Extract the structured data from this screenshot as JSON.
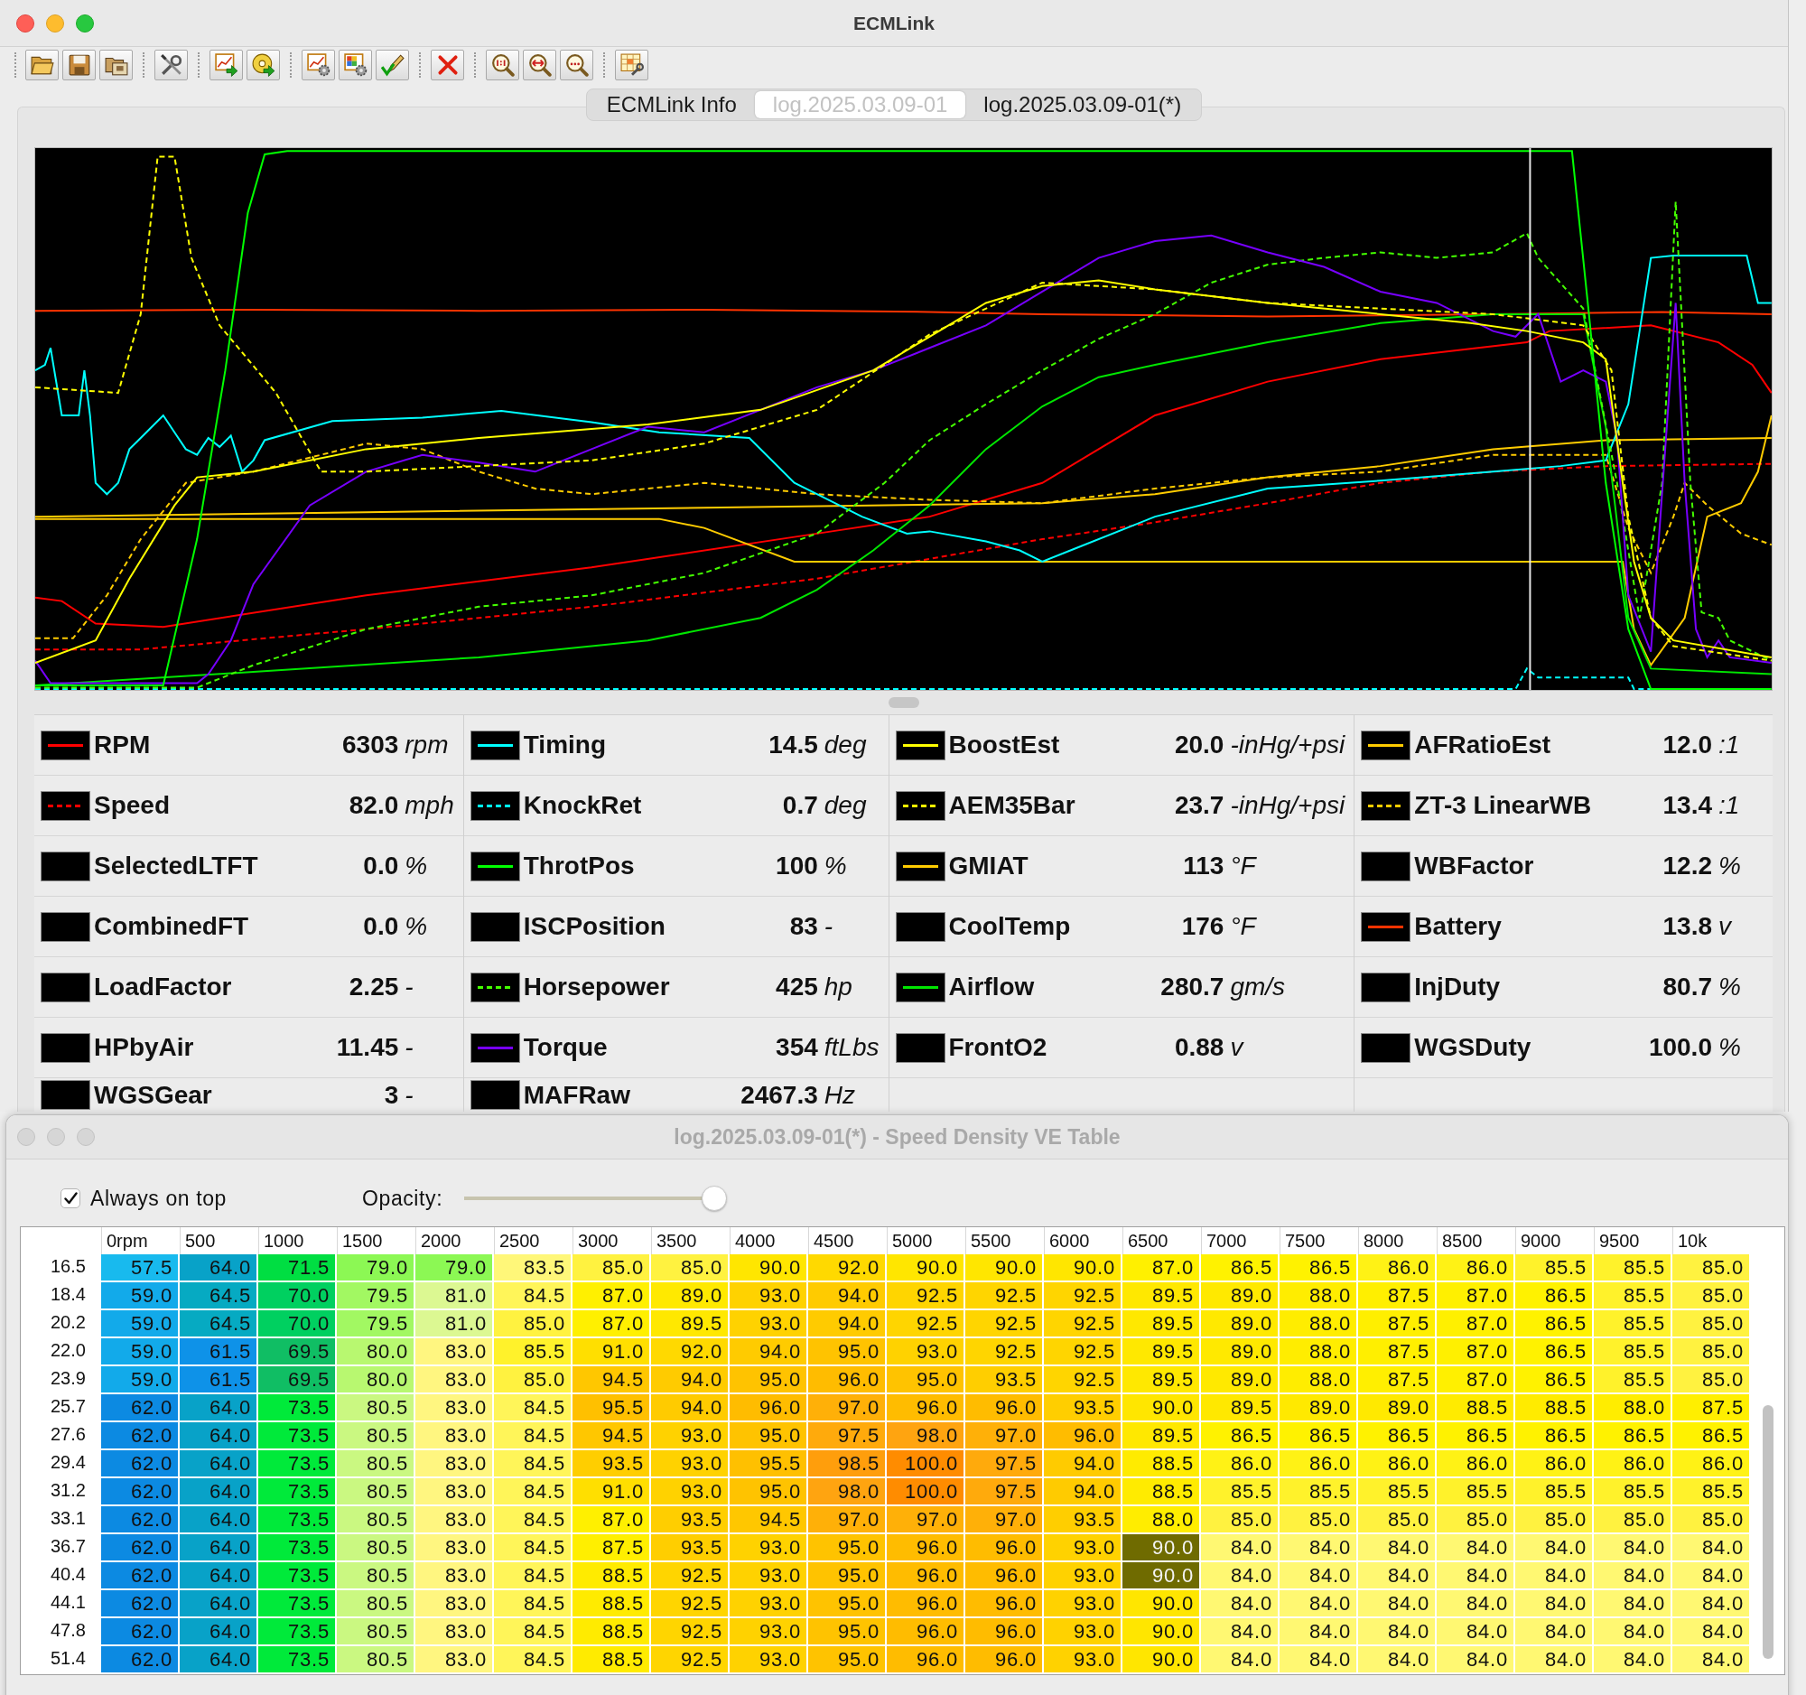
{
  "window": {
    "title": "ECMLink",
    "active": true
  },
  "tabs": [
    {
      "label": "ECMLink Info",
      "selected": false
    },
    {
      "label": "log.2025.03.09-01",
      "selected": true
    },
    {
      "label": "log.2025.03.09-01(*)",
      "selected": false
    }
  ],
  "gauge_columns": [
    {
      "gauges": [
        {
          "name": "RPM",
          "value": "6303",
          "unit": "rpm",
          "kind": "solid",
          "color": "#ff0000"
        },
        {
          "name": "Speed",
          "value": "82.0",
          "unit": "mph",
          "kind": "dashed",
          "color": "#ff0000"
        },
        {
          "name": "SelectedLTFT",
          "value": "0.0",
          "unit": "%",
          "kind": "none"
        },
        {
          "name": "CombinedFT",
          "value": "0.0",
          "unit": "%",
          "kind": "none"
        },
        {
          "name": "LoadFactor",
          "value": "2.25",
          "unit": "-",
          "kind": "none"
        },
        {
          "name": "HPbyAir",
          "value": "11.45",
          "unit": "-",
          "kind": "none"
        },
        {
          "name": "WGSGear",
          "value": "3",
          "unit": "-",
          "kind": "none"
        }
      ]
    },
    {
      "gauges": [
        {
          "name": "Timing",
          "value": "14.5",
          "unit": "deg",
          "kind": "solid",
          "color": "#00ffff"
        },
        {
          "name": "KnockRet",
          "value": "0.7",
          "unit": "deg",
          "kind": "dashed",
          "color": "#00ffff"
        },
        {
          "name": "ThrotPos",
          "value": "100",
          "unit": "%",
          "kind": "solid",
          "color": "#00ff00"
        },
        {
          "name": "ISCPosition",
          "value": "83",
          "unit": "-",
          "kind": "none"
        },
        {
          "name": "Horsepower",
          "value": "425",
          "unit": "hp",
          "kind": "dashed",
          "color": "#44ff00"
        },
        {
          "name": "Torque",
          "value": "354",
          "unit": "ftLbs",
          "kind": "solid",
          "color": "#7700ff"
        },
        {
          "name": "MAFRaw",
          "value": "2467.3",
          "unit": "Hz",
          "kind": "none"
        }
      ]
    },
    {
      "gauges": [
        {
          "name": "BoostEst",
          "value": "20.0",
          "unit": "-inHg/+psi",
          "kind": "solid",
          "color": "#ffff00"
        },
        {
          "name": "AEM35Bar",
          "value": "23.7",
          "unit": "-inHg/+psi",
          "kind": "dashed",
          "color": "#ffff00"
        },
        {
          "name": "GMIAT",
          "value": "113",
          "unit": "°F",
          "kind": "solid",
          "color": "#ffcc00"
        },
        {
          "name": "CoolTemp",
          "value": "176",
          "unit": "°F",
          "kind": "none"
        },
        {
          "name": "Airflow",
          "value": "280.7",
          "unit": "gm/s",
          "kind": "solid",
          "color": "#00e600"
        },
        {
          "name": "FrontO2",
          "value": "0.88",
          "unit": "v",
          "kind": "none"
        }
      ]
    },
    {
      "gauges": [
        {
          "name": "AFRatioEst",
          "value": "12.0",
          "unit": ":1",
          "kind": "solid",
          "color": "#ffcc00"
        },
        {
          "name": "ZT-3 LinearWB",
          "value": "13.4",
          "unit": ":1",
          "kind": "dashed",
          "color": "#ffcc00"
        },
        {
          "name": "WBFactor",
          "value": "12.2",
          "unit": "%",
          "kind": "none"
        },
        {
          "name": "Battery",
          "value": "13.8",
          "unit": "v",
          "kind": "solid",
          "color": "#ff3300"
        },
        {
          "name": "InjDuty",
          "value": "80.7",
          "unit": "%",
          "kind": "none"
        },
        {
          "name": "WGSDuty",
          "value": "100.0",
          "unit": "%",
          "kind": "none"
        }
      ]
    }
  ],
  "ve_window": {
    "title": "log.2025.03.09-01(*) - Speed Density VE Table",
    "active": false,
    "always_on_top": {
      "label": "Always on top",
      "checked": true
    },
    "opacity": {
      "label": "Opacity:",
      "level": 1.0
    },
    "table": {
      "columns": [
        "0rpm",
        "500",
        "1000",
        "1500",
        "2000",
        "2500",
        "3000",
        "3500",
        "4000",
        "4500",
        "5000",
        "5500",
        "6000",
        "6500",
        "7000",
        "7500",
        "8000",
        "8500",
        "9000",
        "9500",
        "10k"
      ],
      "rows": [
        {
          "label": "16.5",
          "cells": [
            {
              "value": "57.5",
              "selected": false
            },
            {
              "value": "64.0",
              "selected": false
            },
            {
              "value": "71.5",
              "selected": false
            },
            {
              "value": "79.0",
              "selected": false
            },
            {
              "value": "79.0",
              "selected": false
            },
            {
              "value": "83.5",
              "selected": false
            },
            {
              "value": "85.0",
              "selected": false
            },
            {
              "value": "85.0",
              "selected": false
            },
            {
              "value": "90.0",
              "selected": false
            },
            {
              "value": "92.0",
              "selected": false
            },
            {
              "value": "90.0",
              "selected": false
            },
            {
              "value": "90.0",
              "selected": false
            },
            {
              "value": "90.0",
              "selected": false
            },
            {
              "value": "87.0",
              "selected": false
            },
            {
              "value": "86.5",
              "selected": false
            },
            {
              "value": "86.5",
              "selected": false
            },
            {
              "value": "86.0",
              "selected": false
            },
            {
              "value": "86.0",
              "selected": false
            },
            {
              "value": "85.5",
              "selected": false
            },
            {
              "value": "85.5",
              "selected": false
            },
            {
              "value": "85.0",
              "selected": false
            }
          ]
        },
        {
          "label": "18.4",
          "cells": [
            {
              "value": "59.0",
              "selected": false
            },
            {
              "value": "64.5",
              "selected": false
            },
            {
              "value": "70.0",
              "selected": false
            },
            {
              "value": "79.5",
              "selected": false
            },
            {
              "value": "81.0",
              "selected": false
            },
            {
              "value": "84.5",
              "selected": false
            },
            {
              "value": "87.0",
              "selected": false
            },
            {
              "value": "89.0",
              "selected": false
            },
            {
              "value": "93.0",
              "selected": false
            },
            {
              "value": "94.0",
              "selected": false
            },
            {
              "value": "92.5",
              "selected": false
            },
            {
              "value": "92.5",
              "selected": false
            },
            {
              "value": "92.5",
              "selected": false
            },
            {
              "value": "89.5",
              "selected": false
            },
            {
              "value": "89.0",
              "selected": false
            },
            {
              "value": "88.0",
              "selected": false
            },
            {
              "value": "87.5",
              "selected": false
            },
            {
              "value": "87.0",
              "selected": false
            },
            {
              "value": "86.5",
              "selected": false
            },
            {
              "value": "85.5",
              "selected": false
            },
            {
              "value": "85.0",
              "selected": false
            }
          ]
        },
        {
          "label": "20.2",
          "cells": [
            {
              "value": "59.0",
              "selected": false
            },
            {
              "value": "64.5",
              "selected": false
            },
            {
              "value": "70.0",
              "selected": false
            },
            {
              "value": "79.5",
              "selected": false
            },
            {
              "value": "81.0",
              "selected": false
            },
            {
              "value": "85.0",
              "selected": false
            },
            {
              "value": "87.0",
              "selected": false
            },
            {
              "value": "89.5",
              "selected": false
            },
            {
              "value": "93.0",
              "selected": false
            },
            {
              "value": "94.0",
              "selected": false
            },
            {
              "value": "92.5",
              "selected": false
            },
            {
              "value": "92.5",
              "selected": false
            },
            {
              "value": "92.5",
              "selected": false
            },
            {
              "value": "89.5",
              "selected": false
            },
            {
              "value": "89.0",
              "selected": false
            },
            {
              "value": "88.0",
              "selected": false
            },
            {
              "value": "87.5",
              "selected": false
            },
            {
              "value": "87.0",
              "selected": false
            },
            {
              "value": "86.5",
              "selected": false
            },
            {
              "value": "85.5",
              "selected": false
            },
            {
              "value": "85.0",
              "selected": false
            }
          ]
        },
        {
          "label": "22.0",
          "cells": [
            {
              "value": "59.0",
              "selected": false
            },
            {
              "value": "61.5",
              "selected": false
            },
            {
              "value": "69.5",
              "selected": false
            },
            {
              "value": "80.0",
              "selected": false
            },
            {
              "value": "83.0",
              "selected": false
            },
            {
              "value": "85.5",
              "selected": false
            },
            {
              "value": "91.0",
              "selected": false
            },
            {
              "value": "92.0",
              "selected": false
            },
            {
              "value": "94.0",
              "selected": false
            },
            {
              "value": "95.0",
              "selected": false
            },
            {
              "value": "93.0",
              "selected": false
            },
            {
              "value": "92.5",
              "selected": false
            },
            {
              "value": "92.5",
              "selected": false
            },
            {
              "value": "89.5",
              "selected": false
            },
            {
              "value": "89.0",
              "selected": false
            },
            {
              "value": "88.0",
              "selected": false
            },
            {
              "value": "87.5",
              "selected": false
            },
            {
              "value": "87.0",
              "selected": false
            },
            {
              "value": "86.5",
              "selected": false
            },
            {
              "value": "85.5",
              "selected": false
            },
            {
              "value": "85.0",
              "selected": false
            }
          ]
        },
        {
          "label": "23.9",
          "cells": [
            {
              "value": "59.0",
              "selected": false
            },
            {
              "value": "61.5",
              "selected": false
            },
            {
              "value": "69.5",
              "selected": false
            },
            {
              "value": "80.0",
              "selected": false
            },
            {
              "value": "83.0",
              "selected": false
            },
            {
              "value": "85.0",
              "selected": false
            },
            {
              "value": "94.5",
              "selected": false
            },
            {
              "value": "94.0",
              "selected": false
            },
            {
              "value": "95.0",
              "selected": false
            },
            {
              "value": "96.0",
              "selected": false
            },
            {
              "value": "95.0",
              "selected": false
            },
            {
              "value": "93.5",
              "selected": false
            },
            {
              "value": "92.5",
              "selected": false
            },
            {
              "value": "89.5",
              "selected": false
            },
            {
              "value": "89.0",
              "selected": false
            },
            {
              "value": "88.0",
              "selected": false
            },
            {
              "value": "87.5",
              "selected": false
            },
            {
              "value": "87.0",
              "selected": false
            },
            {
              "value": "86.5",
              "selected": false
            },
            {
              "value": "85.5",
              "selected": false
            },
            {
              "value": "85.0",
              "selected": false
            }
          ]
        },
        {
          "label": "25.7",
          "cells": [
            {
              "value": "62.0",
              "selected": false
            },
            {
              "value": "64.0",
              "selected": false
            },
            {
              "value": "73.5",
              "selected": false
            },
            {
              "value": "80.5",
              "selected": false
            },
            {
              "value": "83.0",
              "selected": false
            },
            {
              "value": "84.5",
              "selected": false
            },
            {
              "value": "95.5",
              "selected": false
            },
            {
              "value": "94.0",
              "selected": false
            },
            {
              "value": "96.0",
              "selected": false
            },
            {
              "value": "97.0",
              "selected": false
            },
            {
              "value": "96.0",
              "selected": false
            },
            {
              "value": "96.0",
              "selected": false
            },
            {
              "value": "93.5",
              "selected": false
            },
            {
              "value": "90.0",
              "selected": false
            },
            {
              "value": "89.5",
              "selected": false
            },
            {
              "value": "89.0",
              "selected": false
            },
            {
              "value": "89.0",
              "selected": false
            },
            {
              "value": "88.5",
              "selected": false
            },
            {
              "value": "88.5",
              "selected": false
            },
            {
              "value": "88.0",
              "selected": false
            },
            {
              "value": "87.5",
              "selected": false
            }
          ]
        },
        {
          "label": "27.6",
          "cells": [
            {
              "value": "62.0",
              "selected": false
            },
            {
              "value": "64.0",
              "selected": false
            },
            {
              "value": "73.5",
              "selected": false
            },
            {
              "value": "80.5",
              "selected": false
            },
            {
              "value": "83.0",
              "selected": false
            },
            {
              "value": "84.5",
              "selected": false
            },
            {
              "value": "94.5",
              "selected": false
            },
            {
              "value": "93.0",
              "selected": false
            },
            {
              "value": "95.0",
              "selected": false
            },
            {
              "value": "97.5",
              "selected": false
            },
            {
              "value": "98.0",
              "selected": false
            },
            {
              "value": "97.0",
              "selected": false
            },
            {
              "value": "96.0",
              "selected": false
            },
            {
              "value": "89.5",
              "selected": false
            },
            {
              "value": "86.5",
              "selected": false
            },
            {
              "value": "86.5",
              "selected": false
            },
            {
              "value": "86.5",
              "selected": false
            },
            {
              "value": "86.5",
              "selected": false
            },
            {
              "value": "86.5",
              "selected": false
            },
            {
              "value": "86.5",
              "selected": false
            },
            {
              "value": "86.5",
              "selected": false
            }
          ]
        },
        {
          "label": "29.4",
          "cells": [
            {
              "value": "62.0",
              "selected": false
            },
            {
              "value": "64.0",
              "selected": false
            },
            {
              "value": "73.5",
              "selected": false
            },
            {
              "value": "80.5",
              "selected": false
            },
            {
              "value": "83.0",
              "selected": false
            },
            {
              "value": "84.5",
              "selected": false
            },
            {
              "value": "93.5",
              "selected": false
            },
            {
              "value": "93.0",
              "selected": false
            },
            {
              "value": "95.5",
              "selected": false
            },
            {
              "value": "98.5",
              "selected": false
            },
            {
              "value": "100.0",
              "selected": false
            },
            {
              "value": "97.5",
              "selected": false
            },
            {
              "value": "94.0",
              "selected": false
            },
            {
              "value": "88.5",
              "selected": false
            },
            {
              "value": "86.0",
              "selected": false
            },
            {
              "value": "86.0",
              "selected": false
            },
            {
              "value": "86.0",
              "selected": false
            },
            {
              "value": "86.0",
              "selected": false
            },
            {
              "value": "86.0",
              "selected": false
            },
            {
              "value": "86.0",
              "selected": false
            },
            {
              "value": "86.0",
              "selected": false
            }
          ]
        },
        {
          "label": "31.2",
          "cells": [
            {
              "value": "62.0",
              "selected": false
            },
            {
              "value": "64.0",
              "selected": false
            },
            {
              "value": "73.5",
              "selected": false
            },
            {
              "value": "80.5",
              "selected": false
            },
            {
              "value": "83.0",
              "selected": false
            },
            {
              "value": "84.5",
              "selected": false
            },
            {
              "value": "91.0",
              "selected": false
            },
            {
              "value": "93.0",
              "selected": false
            },
            {
              "value": "95.0",
              "selected": false
            },
            {
              "value": "98.0",
              "selected": false
            },
            {
              "value": "100.0",
              "selected": false
            },
            {
              "value": "97.5",
              "selected": false
            },
            {
              "value": "94.0",
              "selected": false
            },
            {
              "value": "88.5",
              "selected": false
            },
            {
              "value": "85.5",
              "selected": false
            },
            {
              "value": "85.5",
              "selected": false
            },
            {
              "value": "85.5",
              "selected": false
            },
            {
              "value": "85.5",
              "selected": false
            },
            {
              "value": "85.5",
              "selected": false
            },
            {
              "value": "85.5",
              "selected": false
            },
            {
              "value": "85.5",
              "selected": false
            }
          ]
        },
        {
          "label": "33.1",
          "cells": [
            {
              "value": "62.0",
              "selected": false
            },
            {
              "value": "64.0",
              "selected": false
            },
            {
              "value": "73.5",
              "selected": false
            },
            {
              "value": "80.5",
              "selected": false
            },
            {
              "value": "83.0",
              "selected": false
            },
            {
              "value": "84.5",
              "selected": false
            },
            {
              "value": "87.0",
              "selected": false
            },
            {
              "value": "93.5",
              "selected": false
            },
            {
              "value": "94.5",
              "selected": false
            },
            {
              "value": "97.0",
              "selected": false
            },
            {
              "value": "97.0",
              "selected": false
            },
            {
              "value": "97.0",
              "selected": false
            },
            {
              "value": "93.5",
              "selected": false
            },
            {
              "value": "88.0",
              "selected": false
            },
            {
              "value": "85.0",
              "selected": false
            },
            {
              "value": "85.0",
              "selected": false
            },
            {
              "value": "85.0",
              "selected": false
            },
            {
              "value": "85.0",
              "selected": false
            },
            {
              "value": "85.0",
              "selected": false
            },
            {
              "value": "85.0",
              "selected": false
            },
            {
              "value": "85.0",
              "selected": false
            }
          ]
        },
        {
          "label": "36.7",
          "cells": [
            {
              "value": "62.0",
              "selected": false
            },
            {
              "value": "64.0",
              "selected": false
            },
            {
              "value": "73.5",
              "selected": false
            },
            {
              "value": "80.5",
              "selected": false
            },
            {
              "value": "83.0",
              "selected": false
            },
            {
              "value": "84.5",
              "selected": false
            },
            {
              "value": "87.5",
              "selected": false
            },
            {
              "value": "93.5",
              "selected": false
            },
            {
              "value": "93.0",
              "selected": false
            },
            {
              "value": "95.0",
              "selected": false
            },
            {
              "value": "96.0",
              "selected": false
            },
            {
              "value": "96.0",
              "selected": false
            },
            {
              "value": "93.0",
              "selected": false
            },
            {
              "value": "90.0",
              "selected": true
            },
            {
              "value": "84.0",
              "selected": false
            },
            {
              "value": "84.0",
              "selected": false
            },
            {
              "value": "84.0",
              "selected": false
            },
            {
              "value": "84.0",
              "selected": false
            },
            {
              "value": "84.0",
              "selected": false
            },
            {
              "value": "84.0",
              "selected": false
            },
            {
              "value": "84.0",
              "selected": false
            }
          ]
        },
        {
          "label": "40.4",
          "cells": [
            {
              "value": "62.0",
              "selected": false
            },
            {
              "value": "64.0",
              "selected": false
            },
            {
              "value": "73.5",
              "selected": false
            },
            {
              "value": "80.5",
              "selected": false
            },
            {
              "value": "83.0",
              "selected": false
            },
            {
              "value": "84.5",
              "selected": false
            },
            {
              "value": "88.5",
              "selected": false
            },
            {
              "value": "92.5",
              "selected": false
            },
            {
              "value": "93.0",
              "selected": false
            },
            {
              "value": "95.0",
              "selected": false
            },
            {
              "value": "96.0",
              "selected": false
            },
            {
              "value": "96.0",
              "selected": false
            },
            {
              "value": "93.0",
              "selected": false
            },
            {
              "value": "90.0",
              "selected": true
            },
            {
              "value": "84.0",
              "selected": false
            },
            {
              "value": "84.0",
              "selected": false
            },
            {
              "value": "84.0",
              "selected": false
            },
            {
              "value": "84.0",
              "selected": false
            },
            {
              "value": "84.0",
              "selected": false
            },
            {
              "value": "84.0",
              "selected": false
            },
            {
              "value": "84.0",
              "selected": false
            }
          ]
        },
        {
          "label": "44.1",
          "cells": [
            {
              "value": "62.0",
              "selected": false
            },
            {
              "value": "64.0",
              "selected": false
            },
            {
              "value": "73.5",
              "selected": false
            },
            {
              "value": "80.5",
              "selected": false
            },
            {
              "value": "83.0",
              "selected": false
            },
            {
              "value": "84.5",
              "selected": false
            },
            {
              "value": "88.5",
              "selected": false
            },
            {
              "value": "92.5",
              "selected": false
            },
            {
              "value": "93.0",
              "selected": false
            },
            {
              "value": "95.0",
              "selected": false
            },
            {
              "value": "96.0",
              "selected": false
            },
            {
              "value": "96.0",
              "selected": false
            },
            {
              "value": "93.0",
              "selected": false
            },
            {
              "value": "90.0",
              "selected": false
            },
            {
              "value": "84.0",
              "selected": false
            },
            {
              "value": "84.0",
              "selected": false
            },
            {
              "value": "84.0",
              "selected": false
            },
            {
              "value": "84.0",
              "selected": false
            },
            {
              "value": "84.0",
              "selected": false
            },
            {
              "value": "84.0",
              "selected": false
            },
            {
              "value": "84.0",
              "selected": false
            }
          ]
        },
        {
          "label": "47.8",
          "cells": [
            {
              "value": "62.0",
              "selected": false
            },
            {
              "value": "64.0",
              "selected": false
            },
            {
              "value": "73.5",
              "selected": false
            },
            {
              "value": "80.5",
              "selected": false
            },
            {
              "value": "83.0",
              "selected": false
            },
            {
              "value": "84.5",
              "selected": false
            },
            {
              "value": "88.5",
              "selected": false
            },
            {
              "value": "92.5",
              "selected": false
            },
            {
              "value": "93.0",
              "selected": false
            },
            {
              "value": "95.0",
              "selected": false
            },
            {
              "value": "96.0",
              "selected": false
            },
            {
              "value": "96.0",
              "selected": false
            },
            {
              "value": "93.0",
              "selected": false
            },
            {
              "value": "90.0",
              "selected": false
            },
            {
              "value": "84.0",
              "selected": false
            },
            {
              "value": "84.0",
              "selected": false
            },
            {
              "value": "84.0",
              "selected": false
            },
            {
              "value": "84.0",
              "selected": false
            },
            {
              "value": "84.0",
              "selected": false
            },
            {
              "value": "84.0",
              "selected": false
            },
            {
              "value": "84.0",
              "selected": false
            }
          ]
        },
        {
          "label": "51.4",
          "cells": [
            {
              "value": "62.0",
              "selected": false
            },
            {
              "value": "64.0",
              "selected": false
            },
            {
              "value": "73.5",
              "selected": false
            },
            {
              "value": "80.5",
              "selected": false
            },
            {
              "value": "83.0",
              "selected": false
            },
            {
              "value": "84.5",
              "selected": false
            },
            {
              "value": "88.5",
              "selected": false
            },
            {
              "value": "92.5",
              "selected": false
            },
            {
              "value": "93.0",
              "selected": false
            },
            {
              "value": "95.0",
              "selected": false
            },
            {
              "value": "96.0",
              "selected": false
            },
            {
              "value": "96.0",
              "selected": false
            },
            {
              "value": "93.0",
              "selected": false
            },
            {
              "value": "90.0",
              "selected": false
            },
            {
              "value": "84.0",
              "selected": false
            },
            {
              "value": "84.0",
              "selected": false
            },
            {
              "value": "84.0",
              "selected": false
            },
            {
              "value": "84.0",
              "selected": false
            },
            {
              "value": "84.0",
              "selected": false
            },
            {
              "value": "84.0",
              "selected": false
            },
            {
              "value": "84.0",
              "selected": false
            }
          ]
        }
      ]
    }
  }
}
